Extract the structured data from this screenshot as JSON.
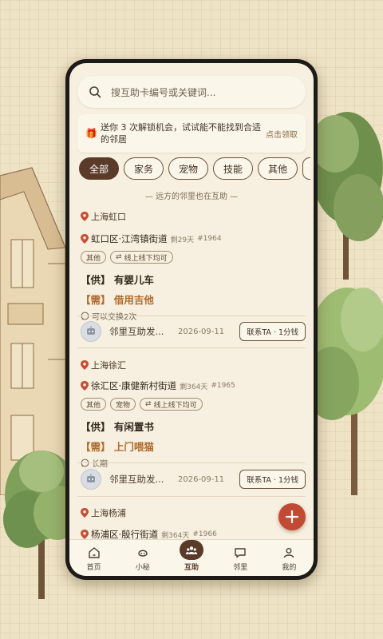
{
  "search": {
    "placeholder": "搜互助卡编号或关键词..."
  },
  "banner": {
    "text": "送你 3 次解锁机会，试试能不能找到合适的邻居",
    "claim_label": "点击领取"
  },
  "tabs": [
    {
      "label": "全部",
      "active": true
    },
    {
      "label": "家务"
    },
    {
      "label": "宠物"
    },
    {
      "label": "技能"
    },
    {
      "label": "其他"
    }
  ],
  "divider": "— 远方的邻里也在互助 —",
  "cards": [
    {
      "region": "上海虹口",
      "street": "虹口区·江湾镇街道",
      "remaining": "剩29天",
      "id": "#1964",
      "tags": [
        "其他"
      ],
      "mode": "线上线下均可",
      "supply": "【供】 有婴儿车",
      "need": "【需】 借用吉他",
      "note": "可以交换2次",
      "poster": {
        "name": "邻里互助发...",
        "date": "2026-09-11",
        "contact": "联系TA · 1分钱"
      }
    },
    {
      "region": "上海徐汇",
      "street": "徐汇区·康健新村街道",
      "remaining": "剩364天",
      "id": "#1965",
      "tags": [
        "其他",
        "宠物"
      ],
      "mode": "线上线下均可",
      "supply": "【供】 有闲置书",
      "need": "【需】 上门喂猫",
      "note": "长期",
      "poster": {
        "name": "邻里互助发...",
        "date": "2026-09-11",
        "contact": "联系TA · 1分钱"
      }
    },
    {
      "region": "上海杨浦",
      "street": "杨浦区·殷行街道",
      "remaining": "剩364天",
      "id": "#1966"
    }
  ],
  "nav": [
    {
      "label": "首页",
      "icon": "home-icon"
    },
    {
      "label": "小秘",
      "icon": "assistant-icon"
    },
    {
      "label": "互助",
      "icon": "group-icon"
    },
    {
      "label": "邻里",
      "icon": "chat-icon"
    },
    {
      "label": "我的",
      "icon": "user-icon"
    }
  ],
  "colors": {
    "accent": "#5a3b2a",
    "fab": "#c24a34",
    "need": "#b06b2d"
  }
}
